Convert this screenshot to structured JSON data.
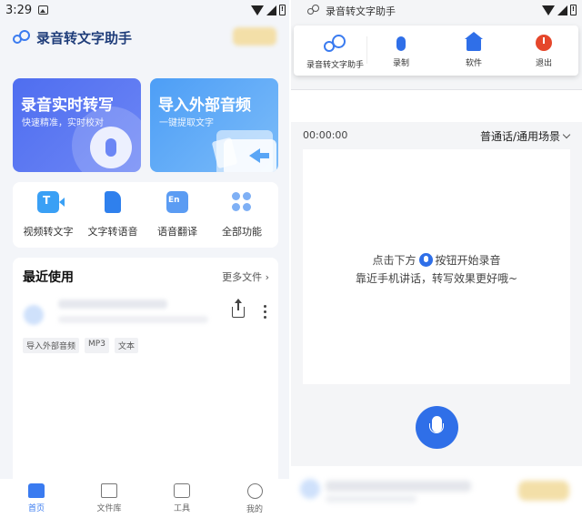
{
  "left": {
    "status": {
      "time": "3:29",
      "battery": "!"
    },
    "app": {
      "title": "录音转文字助手"
    },
    "cards": {
      "record": {
        "title": "录音实时转写",
        "subtitle": "快速精准，实时校对"
      },
      "import": {
        "title": "导入外部音频",
        "subtitle": "一键提取文字"
      }
    },
    "tools": [
      {
        "label": "视频转文字",
        "icon": "video-to-text-icon"
      },
      {
        "label": "文字转语音",
        "icon": "text-to-speech-icon"
      },
      {
        "label": "语音翻译",
        "icon": "voice-translate-icon"
      },
      {
        "label": "全部功能",
        "icon": "all-features-icon"
      }
    ],
    "recent": {
      "title": "最近使用",
      "more": "更多文件",
      "tags": [
        "导入外部音频",
        "MP3",
        "文本"
      ]
    },
    "nav": [
      {
        "label": "首页",
        "active": true
      },
      {
        "label": "文件库",
        "active": false
      },
      {
        "label": "工具",
        "active": false
      },
      {
        "label": "我的",
        "active": false
      }
    ]
  },
  "right": {
    "status": {
      "app_title": "录音转文字助手",
      "battery": "!"
    },
    "menu": [
      {
        "label": "录音转文字助手",
        "icon": "app-logo-icon"
      },
      {
        "label": "录制",
        "icon": "mic-icon"
      },
      {
        "label": "软件",
        "icon": "home-icon"
      },
      {
        "label": "退出",
        "icon": "power-icon"
      }
    ],
    "timer": "00:00:00",
    "scene": "普通话/通用场景",
    "hint": {
      "line1_pre": "点击下方",
      "line1_post": "按钮开始录音",
      "line2": "靠近手机讲话，转写效果更好哦~"
    }
  },
  "colors": {
    "accent": "#2f6fe8",
    "exit": "#e5472b",
    "card_record": "#5574f2",
    "card_import": "#5aa8f7"
  }
}
